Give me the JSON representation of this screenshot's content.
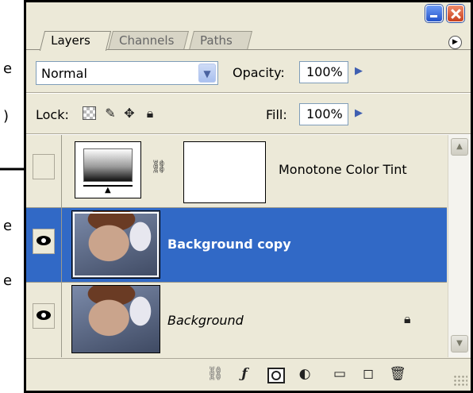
{
  "window": {
    "minimize_icon": "minimize-icon",
    "close_icon": "close-icon"
  },
  "tabs": [
    {
      "label": "Layers",
      "active": true
    },
    {
      "label": "Channels",
      "active": false
    },
    {
      "label": "Paths",
      "active": false
    }
  ],
  "panel_menu_icon": "panel-menu-icon",
  "blend_mode": {
    "value": "Normal"
  },
  "opacity": {
    "label": "Opacity:",
    "value": "100%"
  },
  "lock": {
    "label": "Lock:",
    "icons": [
      "lock-transparent-icon",
      "lock-image-icon",
      "lock-position-icon",
      "lock-all-icon"
    ]
  },
  "fill": {
    "label": "Fill:",
    "value": "100%"
  },
  "layers": [
    {
      "name": "Monotone Color Tint",
      "visible": false,
      "selected": false,
      "type": "adjustment"
    },
    {
      "name": "Background copy",
      "visible": true,
      "selected": true,
      "type": "photo"
    },
    {
      "name": "Background",
      "visible": true,
      "selected": false,
      "type": "photo",
      "locked": true
    }
  ],
  "bottom_bar": [
    "link-icon",
    "layer-style-icon",
    "layer-mask-icon",
    "adjustment-layer-icon",
    "new-group-icon",
    "new-layer-icon",
    "trash-icon"
  ],
  "edge_text": [
    "e",
    ")",
    "e",
    "e"
  ],
  "colors": {
    "selection": "#3169c6",
    "panel": "#ece9d8",
    "field_border": "#7f9db9"
  }
}
